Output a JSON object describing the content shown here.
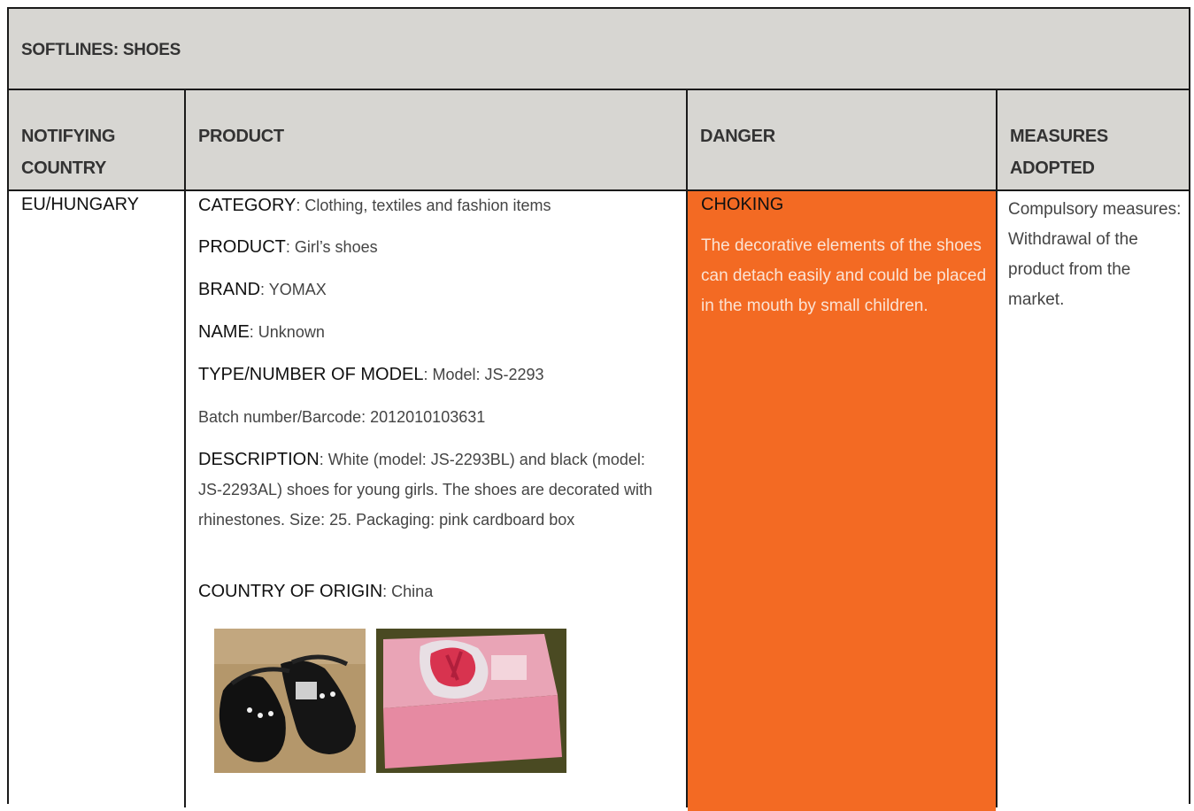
{
  "section": {
    "title": "SOFTLINES: SHOES"
  },
  "headers": {
    "country": "NOTIFYING COUNTRY",
    "product": "PRODUCT",
    "danger": "DANGER",
    "measures": "MEASURES ADOPTED"
  },
  "row": {
    "country": "EU/HUNGARY",
    "fields": {
      "category_key": "CATEGORY",
      "category_val": ": Clothing, textiles and fashion items",
      "product_key": "PRODUCT",
      "product_val": ": Girl’s shoes",
      "brand_key": "BRAND",
      "brand_val": ": YOMAX",
      "name_key": "NAME",
      "name_val": ": Unknown",
      "type_key": "TYPE/NUMBER OF MODEL",
      "type_val": ": Model: JS-2293",
      "batch": "Batch number/Barcode: 2012010103631",
      "description_key": "DESCRIPTION",
      "description_val": ": White (model: JS-2293BL) and black (model: JS-2293AL) shoes for young girls. The shoes are decorated with rhinestones. Size: 25. Packaging: pink cardboard box",
      "origin_key": "COUNTRY OF ORIGIN",
      "origin_val": ": China"
    },
    "danger_title": "CHOKING",
    "danger_text": "The decorative elements of the shoes can detach easily and could be placed in the mouth by small children.",
    "measures": "Compulsory measures: Withdrawal of the product from the market."
  },
  "colors": {
    "header_bg": "#d7d6d2",
    "danger_bg": "#f36a23",
    "border": "#1a1a1a"
  }
}
